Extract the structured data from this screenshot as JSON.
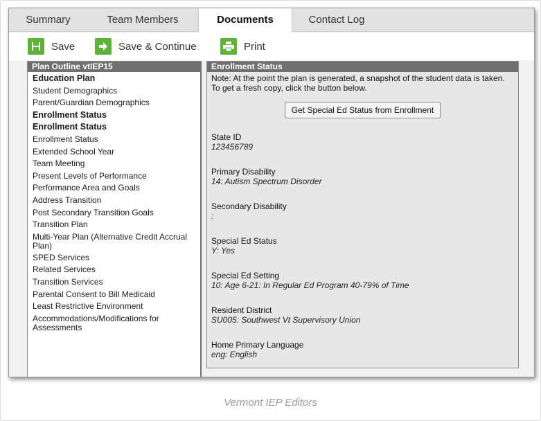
{
  "tabs": [
    "Summary",
    "Team Members",
    "Documents",
    "Contact Log"
  ],
  "active_tab": "Documents",
  "toolbar": {
    "save": "Save",
    "save_continue": "Save & Continue",
    "print": "Print"
  },
  "outline": {
    "header": "Plan Outline vtIEP15",
    "items": [
      {
        "label": "Education Plan",
        "bold": true
      },
      {
        "label": "Student Demographics"
      },
      {
        "label": "Parent/Guardian Demographics"
      },
      {
        "label": "Enrollment Status",
        "bold": true
      },
      {
        "label": "Enrollment Status",
        "bold": true
      },
      {
        "label": "Enrollment Status"
      },
      {
        "label": "Extended School Year"
      },
      {
        "label": "Team Meeting"
      },
      {
        "label": "Present Levels of Performance"
      },
      {
        "label": "Performance Area and Goals"
      },
      {
        "label": "Address Transition"
      },
      {
        "label": "Post Secondary Transition Goals"
      },
      {
        "label": "Transition Plan"
      },
      {
        "label": "Multi-Year Plan (Alternative Credit Accrual Plan)"
      },
      {
        "label": "SPED Services"
      },
      {
        "label": "Related Services"
      },
      {
        "label": "Transition Services"
      },
      {
        "label": "Parental Consent to Bill Medicaid"
      },
      {
        "label": "Least Restrictive Environment"
      },
      {
        "label": "Accommodations/Modifications for Assessments"
      }
    ]
  },
  "detail": {
    "header": "Enrollment Status",
    "note": "Note: At the point the plan is generated, a snapshot of the student data is taken. To get a fresh copy, click the button below.",
    "button": "Get Special Ed Status from Enrollment",
    "fields": [
      {
        "label": "State ID",
        "value": "123456789"
      },
      {
        "label": "Primary Disability",
        "value": "14: Autism Spectrum Disorder"
      },
      {
        "label": "Secondary Disability",
        "value": ":"
      },
      {
        "label": "Special Ed Status",
        "value": "Y: Yes"
      },
      {
        "label": "Special Ed Setting",
        "value": "10: Age 6-21: In Regular Ed Program 40-79% of Time"
      },
      {
        "label": "Resident District",
        "value": "SU005: Southwest Vt Supervisory Union"
      },
      {
        "label": "Home Primary Language",
        "value": "eng: English"
      }
    ]
  },
  "caption": "Vermont IEP Editors"
}
